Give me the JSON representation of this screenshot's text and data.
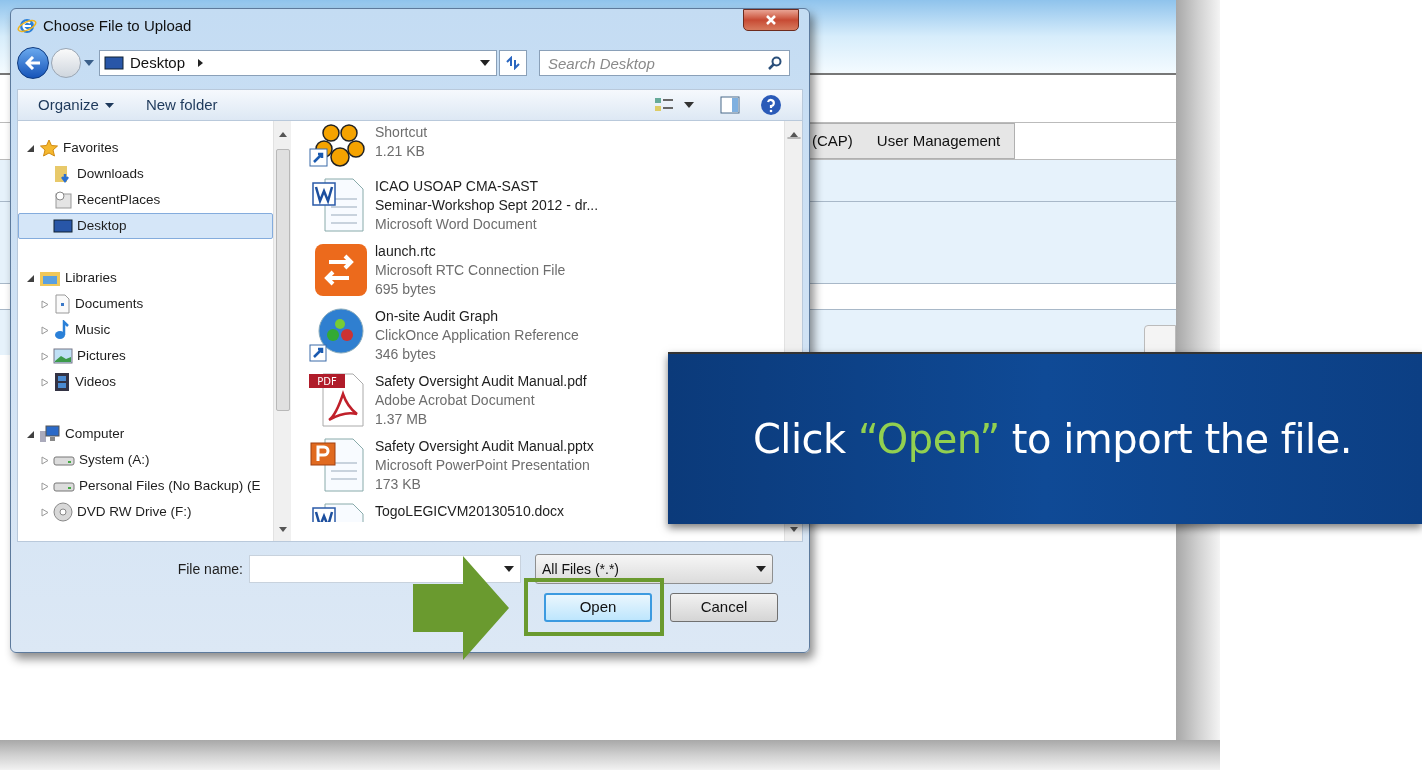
{
  "background_window": {
    "tabs": [
      {
        "label": "(CAP)"
      },
      {
        "label": "User Management"
      }
    ]
  },
  "dialog": {
    "title": "Choose File to Upload",
    "address": {
      "location": "Desktop"
    },
    "search": {
      "placeholder": "Search Desktop"
    },
    "toolbar": {
      "organize": "Organize",
      "new_folder": "New folder"
    },
    "nav": [
      {
        "label": "Favorites",
        "kind": "star",
        "expanded": true,
        "selected": false,
        "children": [
          {
            "label": "Downloads",
            "kind": "downloads",
            "selected": false
          },
          {
            "label": "RecentPlaces",
            "kind": "recent",
            "selected": false
          },
          {
            "label": "Desktop",
            "kind": "desktop",
            "selected": true
          }
        ]
      },
      {
        "label": "Libraries",
        "kind": "library",
        "expanded": true,
        "selected": false,
        "children": [
          {
            "label": "Documents",
            "kind": "document",
            "expanded": false,
            "selected": false
          },
          {
            "label": "Music",
            "kind": "music",
            "expanded": false,
            "selected": false
          },
          {
            "label": "Pictures",
            "kind": "pictures",
            "expanded": false,
            "selected": false
          },
          {
            "label": "Videos",
            "kind": "videos",
            "expanded": false,
            "selected": false
          }
        ]
      },
      {
        "label": "Computer",
        "kind": "computer",
        "expanded": true,
        "selected": false,
        "children": [
          {
            "label": "System (A:)",
            "kind": "drive",
            "expanded": false,
            "selected": false
          },
          {
            "label": "Personal Files (No Backup) (E",
            "kind": "drive",
            "expanded": false,
            "selected": false
          },
          {
            "label": "DVD RW Drive (F:)",
            "kind": "dvd",
            "expanded": false,
            "selected": false
          }
        ]
      }
    ],
    "files": [
      {
        "kind": "shortcut",
        "type": "Shortcut",
        "size": "1.21 KB"
      },
      {
        "kind": "word",
        "name_lines": [
          "ICAO USOAP CMA-SAST",
          "Seminar-Workshop Sept 2012 - dr..."
        ],
        "type": "Microsoft Word Document"
      },
      {
        "kind": "rtc",
        "name_lines": [
          "launch.rtc"
        ],
        "type": "Microsoft RTC Connection File",
        "size": "695 bytes"
      },
      {
        "kind": "clickonce",
        "name_lines": [
          "On-site Audit Graph"
        ],
        "type": "ClickOnce Application Reference",
        "size": "346 bytes"
      },
      {
        "kind": "pdf",
        "name_lines": [
          "Safety Oversight Audit Manual.pdf"
        ],
        "type": "Adobe Acrobat Document",
        "size": "1.37 MB",
        "badge": "PDF"
      },
      {
        "kind": "pptx",
        "name_lines": [
          "Safety Oversight Audit Manual.pptx"
        ],
        "type": "Microsoft PowerPoint Presentation",
        "size": "173 KB"
      },
      {
        "kind": "docx",
        "name_lines": [
          "TogoLEGICVM20130510.docx"
        ]
      }
    ],
    "file_name_label": "File name:",
    "file_type": "All Files (*.*)",
    "open_button": "Open",
    "cancel_button": "Cancel"
  },
  "callout": {
    "before": "Click ",
    "highlight": "“Open”",
    "after": " to import the file."
  }
}
